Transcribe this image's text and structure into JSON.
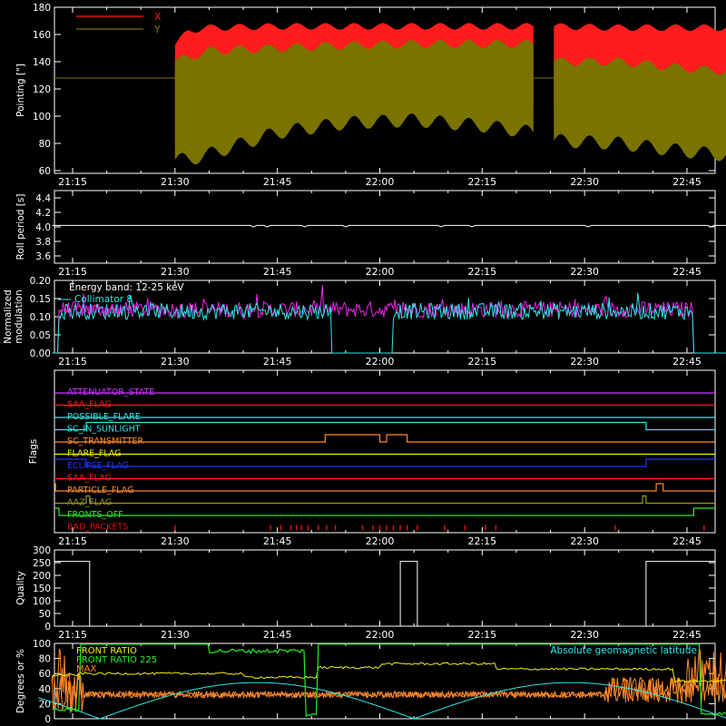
{
  "colors": {
    "bg": "#000000",
    "axes": "#ffffff",
    "red": "#ff1c1c",
    "olive": "#7a7300",
    "cyan": "#2ee6e6",
    "magenta": "#ee22ee",
    "orange": "#ff8a2a",
    "yellow": "#f0f000",
    "green": "#22ee22",
    "blue": "#2233ff",
    "purple": "#cc33ff",
    "dkred": "#dd1111",
    "aaz": "#999922"
  },
  "time_axis": {
    "ticks": [
      "21:15",
      "21:30",
      "21:45",
      "22:00",
      "22:15",
      "22:30",
      "22:45"
    ],
    "range_min": [
      0,
      100
    ]
  },
  "chart_data": [
    {
      "id": "pointing",
      "type": "area",
      "ylabel": "Pointing [\"]",
      "ylim": [
        58,
        180
      ],
      "yticks": [
        "60",
        "80",
        "100",
        "120",
        "140",
        "160",
        "180"
      ],
      "reference_line": 128,
      "legend": [
        "X",
        "Y"
      ],
      "series": [
        {
          "name": "X",
          "color_key": "red",
          "segments": [
            {
              "t": [
                15,
                17,
                20,
                30,
                40,
                50,
                60,
                67.5
              ],
              "upper": [
                152,
                163,
                165,
                166,
                166,
                166,
                166,
                166
              ],
              "lower": [
                80,
                82,
                88,
                100,
                105,
                108,
                108,
                108
              ]
            },
            {
              "t": [
                70.5,
                80,
                90,
                99
              ],
              "upper": [
                166,
                165,
                165,
                165
              ],
              "lower": [
                108,
                108,
                108,
                108
              ]
            }
          ]
        },
        {
          "name": "Y",
          "color_key": "olive",
          "segments": [
            {
              "t": [
                15,
                17,
                20,
                30,
                40,
                50,
                60,
                67.5
              ],
              "upper": [
                140,
                143,
                148,
                150,
                152,
                153,
                153,
                153
              ],
              "lower": [
                68,
                68,
                72,
                88,
                95,
                97,
                93,
                88
              ]
            },
            {
              "t": [
                70.5,
                80,
                90,
                99
              ],
              "upper": [
                140,
                140,
                135,
                132
              ],
              "lower": [
                82,
                80,
                74,
                70
              ]
            }
          ]
        }
      ]
    },
    {
      "id": "roll",
      "type": "line",
      "ylabel": "Roll period [s]",
      "ylim": [
        3.5,
        4.5
      ],
      "yticks": [
        "3.6",
        "3.8",
        "4.0",
        "4.2",
        "4.4"
      ],
      "series": [
        {
          "name": "",
          "color_key": "axes",
          "level": 4.02
        }
      ]
    },
    {
      "id": "modulation",
      "type": "line",
      "ylabel": "Normalized modulation",
      "ylim": [
        0,
        0.2
      ],
      "yticks": [
        "0.00",
        "0.05",
        "0.10",
        "0.15",
        "0.20"
      ],
      "annotation": "Energy band: 12-25 keV",
      "series": [
        {
          "name": "Collimator 8",
          "color_key": "cyan",
          "on": [
            [
              13,
              53
            ],
            [
              62,
              106
            ]
          ],
          "mean": 0.115
        },
        {
          "name": "Collimator 9",
          "color_key": "magenta",
          "on": [
            [
              13,
              106
            ]
          ],
          "mean": 0.12
        }
      ]
    },
    {
      "id": "flags",
      "type": "line",
      "ylabel": "Flags",
      "series": [
        {
          "name": "ATTENUATOR_STATE",
          "color_key": "purple",
          "steps": []
        },
        {
          "name": "SAA_FLAG",
          "color_key": "red",
          "steps": []
        },
        {
          "name": "POSSIBLE_FLARE",
          "color_key": "cyan",
          "steps": []
        },
        {
          "name": "SC_IN_SUNLIGHT",
          "color_key": "cyan",
          "steps": [
            [
              0,
              0
            ],
            [
              17,
              1
            ],
            [
              99,
              0
            ]
          ]
        },
        {
          "name": "SC_TRANSMITTER",
          "color_key": "orange",
          "steps": [
            [
              0,
              0
            ],
            [
              52,
              1
            ],
            [
              60,
              0
            ],
            [
              61,
              1
            ],
            [
              64,
              0
            ]
          ]
        },
        {
          "name": "FLARE_FLAG",
          "color_key": "yellow",
          "steps": []
        },
        {
          "name": "ECLIPSE_FLAG",
          "color_key": "blue",
          "steps": [
            [
              0,
              1
            ],
            [
              17,
              0
            ],
            [
              99,
              1
            ]
          ]
        },
        {
          "name": "SAA_FLAG",
          "color_key": "red",
          "steps": []
        },
        {
          "name": "PARTICLE_FLAG",
          "color_key": "orange",
          "steps": [
            [
              0,
              1
            ],
            [
              12.5,
              0
            ],
            [
              100.5,
              1
            ],
            [
              101.5,
              0
            ]
          ]
        },
        {
          "name": "AAZ_FLAG",
          "color_key": "aaz",
          "steps": [
            [
              0,
              0
            ],
            [
              17,
              1
            ],
            [
              17.5,
              0
            ],
            [
              98.5,
              1
            ],
            [
              99,
              0
            ]
          ]
        },
        {
          "name": "FRONTS_OFF",
          "color_key": "green",
          "steps": [
            [
              0,
              1
            ],
            [
              13,
              0
            ],
            [
              106,
              1
            ]
          ]
        },
        {
          "name": "BAD_PACKETS",
          "color_key": "dkred",
          "ticks": [
            30,
            44,
            45.5,
            47,
            47.8,
            48.5,
            49.5,
            51,
            52.2,
            53.5,
            57.5,
            59,
            60,
            61,
            62,
            63,
            64,
            65.5,
            69.5,
            72.5,
            75.5,
            77,
            94.5,
            107.5,
            127
          ]
        }
      ]
    },
    {
      "id": "quality",
      "type": "line",
      "ylabel": "Quality",
      "ylim": [
        0,
        300
      ],
      "yticks": [
        "0",
        "50",
        "100",
        "150",
        "200",
        "250",
        "300"
      ],
      "series": [
        {
          "name": "",
          "color_key": "axes",
          "steps": [
            [
              0,
              255
            ],
            [
              17.5,
              0
            ],
            [
              63,
              255
            ],
            [
              65.5,
              0
            ],
            [
              99,
              255
            ]
          ]
        }
      ]
    },
    {
      "id": "rates",
      "type": "line",
      "ylabel": "Degrees or %",
      "ylim": [
        0,
        100
      ],
      "yticks": [
        "0",
        "20",
        "40",
        "60",
        "80",
        "100"
      ],
      "legend_right": "Absolute geomagnetic latitude",
      "series": [
        {
          "name": "FRONT RATIO 225",
          "color_key": "green",
          "segments": [
            [
              0,
              16,
              10
            ],
            [
              16,
              49,
              99
            ],
            [
              49,
              51,
              3
            ],
            [
              51,
              107,
              99
            ],
            [
              107,
              140,
              5
            ]
          ],
          "note": ""
        },
        {
          "name": "",
          "color_key": "green",
          "label_only": true
        },
        {
          "name": "",
          "color_key": "orange",
          "label_only": true
        },
        {
          "name": "Absolute geomagnetic latitude",
          "color_key": "cyan",
          "fn": "geomag"
        },
        {
          "name": "",
          "color_key": "yellow",
          "levels": [
            [
              0,
              58
            ],
            [
              16,
              60
            ],
            [
              40,
              55
            ],
            [
              51,
              68
            ],
            [
              60,
              73
            ],
            [
              77,
              66
            ],
            [
              103,
              50
            ]
          ]
        },
        {
          "name": "",
          "color_key": "orange",
          "levels": [
            [
              0,
              35
            ],
            [
              16,
              35
            ],
            [
              50,
              33
            ],
            [
              77,
              32
            ],
            [
              103,
              38
            ]
          ]
        }
      ]
    }
  ],
  "front_labels": [
    "FRONT RATIO",
    "FRONT RATIO 225",
    "MAX"
  ]
}
